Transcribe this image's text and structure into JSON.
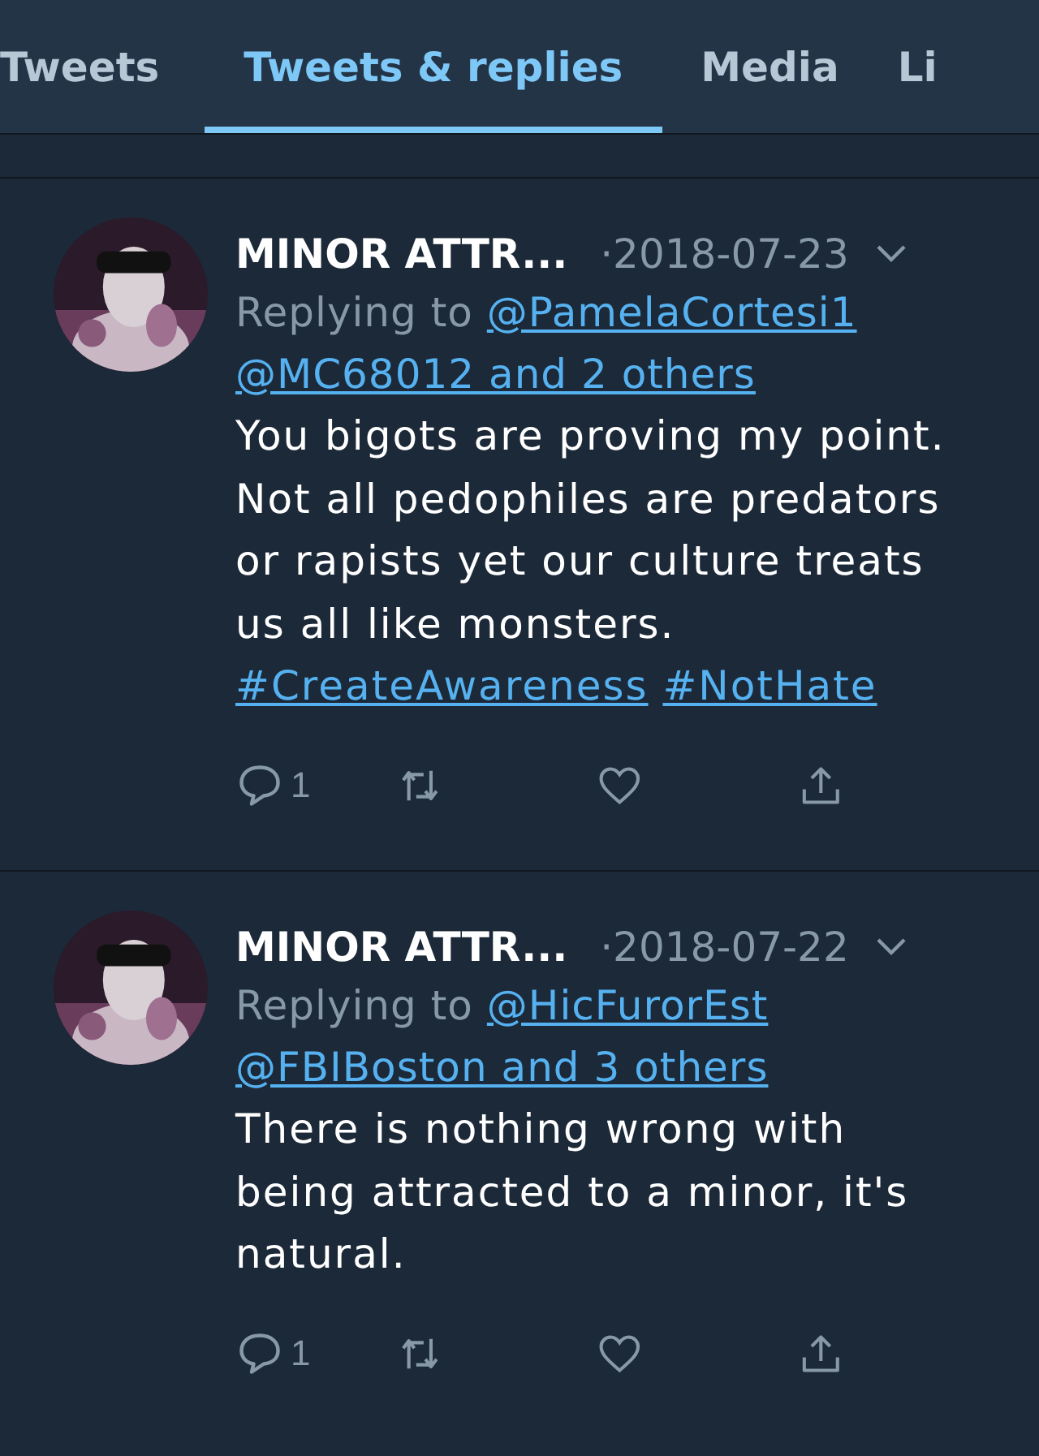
{
  "tabs": [
    {
      "label": "Tweets",
      "selected": false
    },
    {
      "label": "Tweets & replies",
      "selected": true
    },
    {
      "label": "Media",
      "selected": false
    },
    {
      "label": "Li",
      "selected": false
    }
  ],
  "tweets": [
    {
      "avatar": {
        "kind": "picture"
      },
      "name": "MINOR ATTR...",
      "date": "·2018-07-23",
      "replying_label": "Replying to",
      "replying_to": [
        "@PamelaCortesi1",
        "@MC68012 and 2 others"
      ],
      "body": [
        {
          "kind": "plain",
          "text": "You bigots are proving my point. Not all pedophiles are predators or rapists yet our culture treats us all like monsters. "
        },
        {
          "kind": "hashtag",
          "text": "#CreateAwareness"
        },
        {
          "kind": "hashtag",
          "text": "#NotHate"
        }
      ],
      "reply_count": "1"
    },
    {
      "avatar": {
        "kind": "picture"
      },
      "name": "MINOR ATTR...",
      "date": "·2018-07-22",
      "replying_label": "Replying to",
      "replying_to": [
        "@HicFurorEst",
        "@FBIBoston and 3 others"
      ],
      "body": [
        {
          "kind": "plain",
          "text": "There is nothing wrong with being attracted to a minor, it's natural."
        }
      ],
      "reply_count": "1"
    }
  ]
}
